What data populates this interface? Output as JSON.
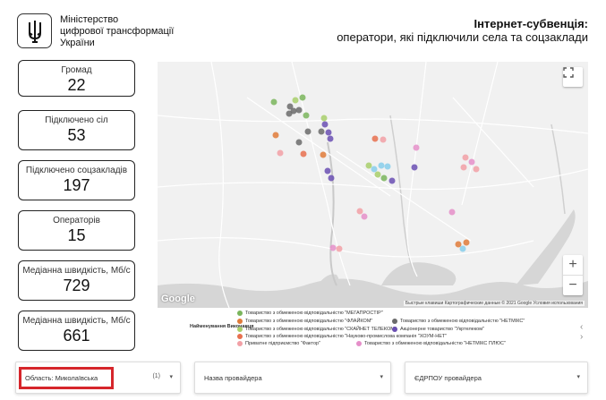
{
  "header": {
    "ministry_line1": "Міністерство",
    "ministry_line2": "цифрової трансформації",
    "ministry_line3": "України",
    "title": "Інтернет-субвенція:",
    "subtitle": "оператори, які підключили села та соцзаклади"
  },
  "kpis": [
    {
      "label": "Громад",
      "value": "22"
    },
    {
      "label": "Підключено сіл",
      "value": "53"
    },
    {
      "label": "Підключено соцзакладів",
      "value": "197"
    },
    {
      "label": "Операторів",
      "value": "15"
    },
    {
      "label": "Медіанна швидкість, Мб/с",
      "value": "729"
    },
    {
      "label": "Медіанна швидкість, Мб/с",
      "value": "661"
    }
  ],
  "map": {
    "google_logo": "Google",
    "attribution": "Быстрые клавиши   Картографические данные © 2021 Google   Условия использования",
    "zoom_in": "+",
    "zoom_out": "−"
  },
  "legend": {
    "title": "Найменування Виконавця",
    "items": [
      {
        "label": "Товариство з обмеженою відповідальністю \"МЕГАПРОСТІР\"",
        "color": "#7ab55c"
      },
      {
        "label": "Товариство з обмеженою відповідальністю \"ФЛАЙКОМ\"",
        "color": "#e07b3a"
      },
      {
        "label": "Товариство з обмеженою відповідальністю \"НЕТМІКС\"",
        "color": "#6b6b6b"
      },
      {
        "label": "Товариство з обмеженою відповідальністю \"СКАЙНЕТ ТЕЛЕКОМ\"",
        "color": "#a8cf6b"
      },
      {
        "label": "Акціонерне товариство \"Укртелеком\"",
        "color": "#6a4fb3"
      },
      {
        "label": "Товариство з обмеженою відповідальністю \"Науково-промислова компанія \"ХОУМ-НЕТ\"",
        "color": "#e8704f"
      },
      {
        "label": "Приватне підприємство \"Фактор\"",
        "color": "#f2a0a6"
      },
      {
        "label": "Товариство з обмеженою відповідальністю \"НЕТМІКС ПЛЮС\"",
        "color": "#e58fc9"
      }
    ],
    "prev": "‹",
    "next": "›"
  },
  "filters": [
    {
      "label": "Область: Миколаївська",
      "count": "(1)"
    },
    {
      "label": "Назва провайдера",
      "count": ""
    },
    {
      "label": "ЄДРПОУ провайдера",
      "count": ""
    }
  ],
  "colors": {
    "accent_highlight": "#d6262b",
    "map_water": "#d6d6d6",
    "map_land": "#f1f1f1"
  }
}
